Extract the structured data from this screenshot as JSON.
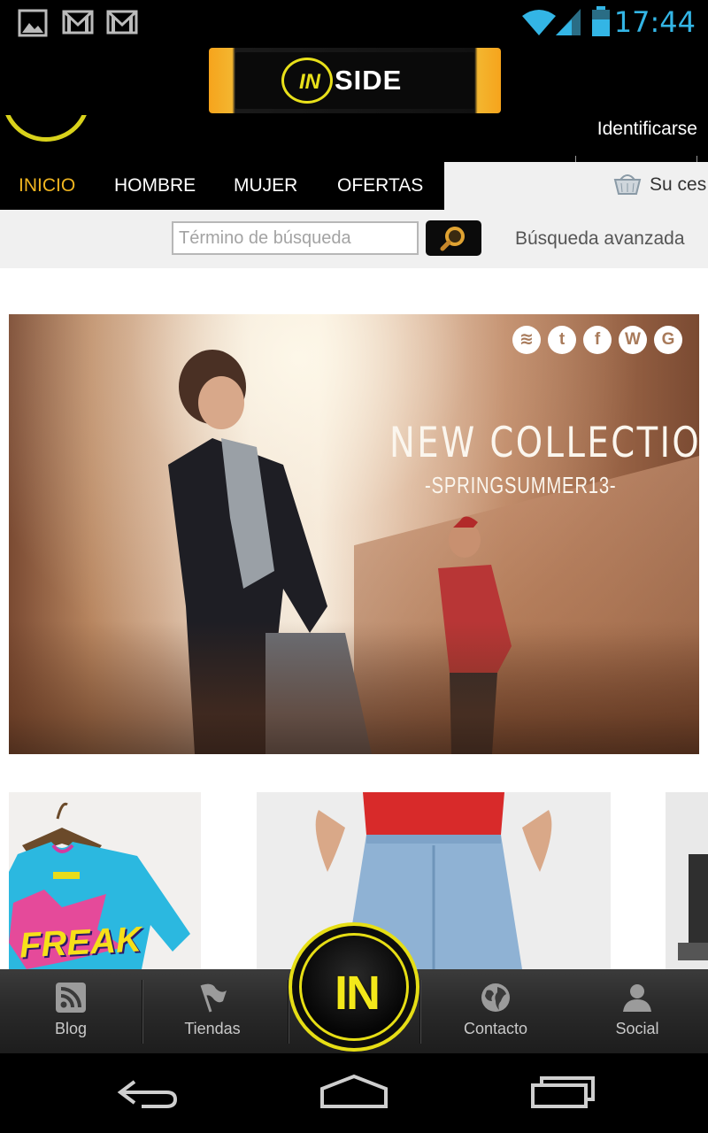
{
  "status_bar": {
    "time": "17:44",
    "icons": [
      "image-icon",
      "gmail-icon",
      "gmail-icon",
      "wifi-icon",
      "signal-icon",
      "battery-icon"
    ],
    "accent_color": "#33b5e5"
  },
  "app_header": {
    "logo_in": "IN",
    "logo_side": "SIDE"
  },
  "site_header": {
    "login": "Identificarse",
    "nav": [
      "INICIO",
      "HOMBRE",
      "MUJER",
      "OFERTAS"
    ],
    "active_nav": "INICIO",
    "active_color": "#f0b520",
    "cart_label": "Su ces"
  },
  "search": {
    "placeholder": "Término de búsqueda",
    "advanced": "Búsqueda avanzada"
  },
  "hero": {
    "title": "NEW COLLECTION",
    "subtitle": "-SPRINGSUMMER13-",
    "social_icons": [
      "spotify-icon",
      "twitter-icon",
      "facebook-icon",
      "wordpress-icon",
      "google-icon"
    ]
  },
  "products": {
    "shirt_print": "FREAK"
  },
  "tabbar": {
    "tabs": [
      "Blog",
      "Tiendas",
      "Contacto",
      "Social"
    ],
    "center_label": "IN",
    "brand_yellow": "#e6de15"
  },
  "system_nav": {
    "buttons": [
      "back-icon",
      "home-icon",
      "recent-apps-icon"
    ]
  }
}
